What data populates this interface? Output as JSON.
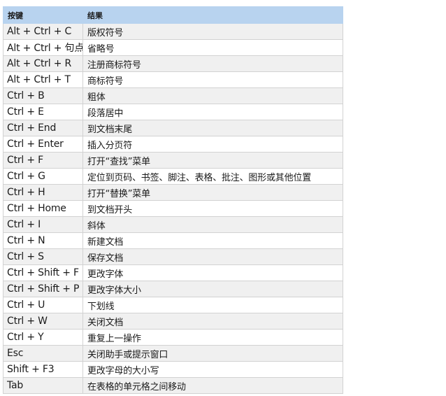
{
  "table": {
    "headers": [
      "按键",
      "结果"
    ],
    "rows": [
      {
        "key": "Alt + Ctrl + C",
        "result": "版权符号"
      },
      {
        "key": "Alt + Ctrl + 句点",
        "result": "省略号"
      },
      {
        "key": "Alt + Ctrl + R",
        "result": "注册商标符号"
      },
      {
        "key": "Alt + Ctrl + T",
        "result": "商标符号"
      },
      {
        "key": "Ctrl + B",
        "result": "粗体"
      },
      {
        "key": "Ctrl + E",
        "result": "段落居中"
      },
      {
        "key": "Ctrl + End",
        "result": "到文档末尾"
      },
      {
        "key": "Ctrl + Enter",
        "result": "插入分页符"
      },
      {
        "key": "Ctrl + F",
        "result": "打开“查找”菜单"
      },
      {
        "key": "Ctrl + G",
        "result": "定位到页码、书签、脚注、表格、批注、图形或其他位置"
      },
      {
        "key": "Ctrl + H",
        "result": "打开“替换”菜单"
      },
      {
        "key": "Ctrl + Home",
        "result": "到文档开头"
      },
      {
        "key": "Ctrl + I",
        "result": "斜体"
      },
      {
        "key": "Ctrl + N",
        "result": "新建文档"
      },
      {
        "key": "Ctrl + S",
        "result": "保存文档"
      },
      {
        "key": "Ctrl + Shift + F",
        "result": "更改字体"
      },
      {
        "key": "Ctrl + Shift + P",
        "result": "更改字体大小"
      },
      {
        "key": "Ctrl + U",
        "result": "下划线"
      },
      {
        "key": "Ctrl + W",
        "result": "关闭文档"
      },
      {
        "key": "Ctrl + Y",
        "result": "重复上一操作"
      },
      {
        "key": "Esc",
        "result": "关闭助手或提示窗口"
      },
      {
        "key": "Shift + F3",
        "result": "更改字母的大小写"
      },
      {
        "key": "Tab",
        "result": "在表格的单元格之间移动"
      }
    ]
  },
  "colors": {
    "header_bg": "#b8d3ef",
    "stripe_bg": "#f0f0f0",
    "row_bg": "#ffffff",
    "border": "#d2d2d2"
  }
}
